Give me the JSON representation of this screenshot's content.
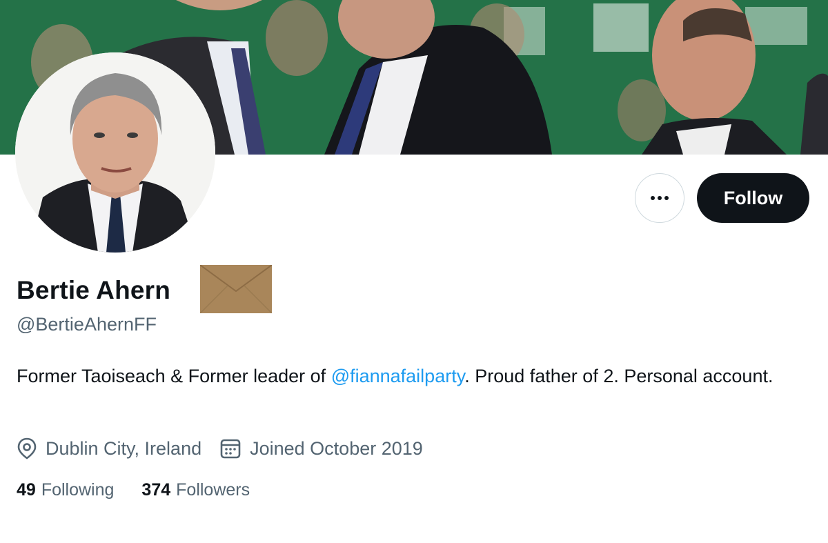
{
  "profile": {
    "display_name": "Bertie Ahern",
    "handle": "@BertieAhernFF",
    "bio_before": "Former Taoiseach & Former leader of ",
    "bio_mention": "@fiannafailparty",
    "bio_after": ". Proud father of 2. Personal account.",
    "location": "Dublin City, Ireland",
    "joined": "Joined October 2019",
    "following_count": "49",
    "following_label": "Following",
    "followers_count": "374",
    "followers_label": "Followers"
  },
  "actions": {
    "follow_label": "Follow",
    "more_icon": "more-horizontal-icon"
  },
  "icons": {
    "location": "location-pin-icon",
    "calendar": "calendar-icon",
    "envelope": "envelope-emoji-icon"
  },
  "colors": {
    "accent": "#1d9bf0",
    "follow_button_bg": "#0f1419",
    "secondary_text": "#536471",
    "banner_green": "#1f6b42"
  }
}
